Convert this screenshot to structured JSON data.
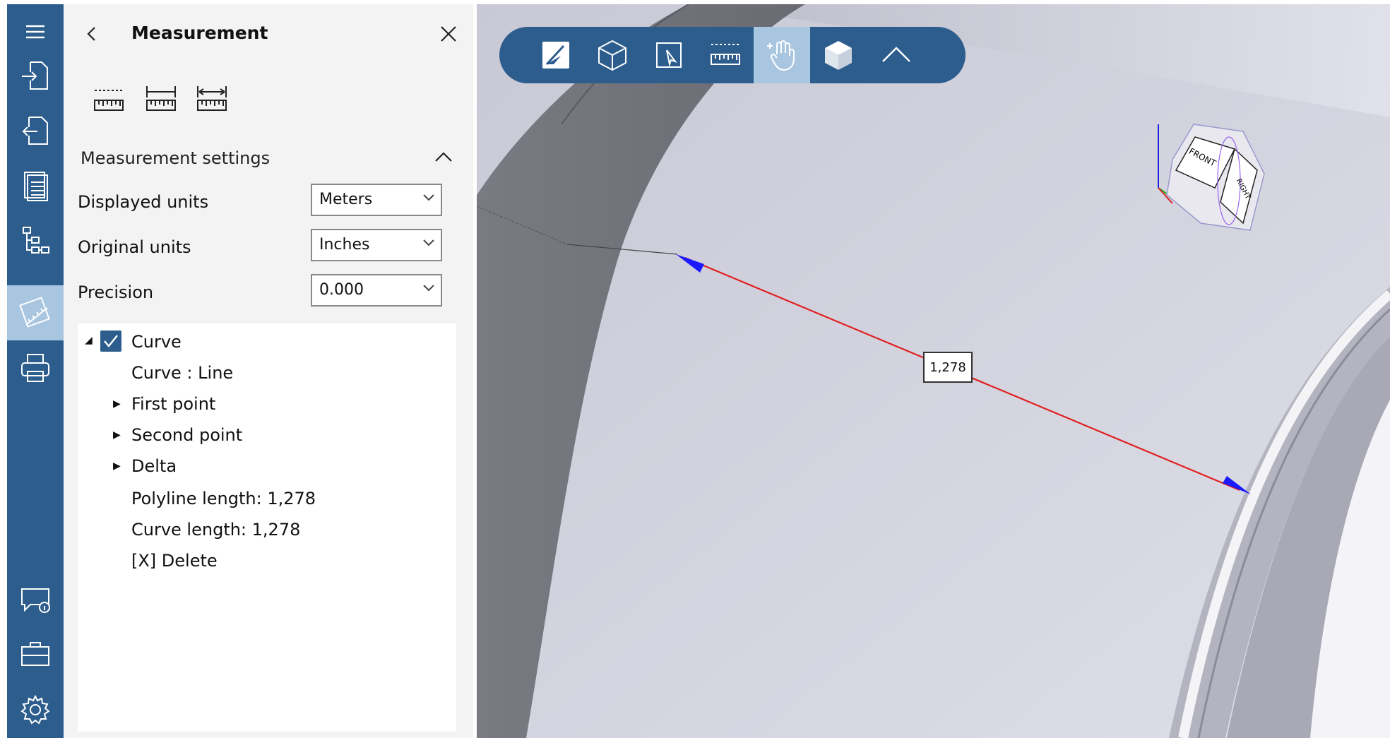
{
  "panel": {
    "title": "Measurement",
    "settings_title": "Measurement settings",
    "settings": [
      {
        "label": "Displayed units",
        "value": "Meters"
      },
      {
        "label": "Original units",
        "value": "Inches"
      },
      {
        "label": "Precision",
        "value": "0.000"
      }
    ],
    "tree": {
      "root": "Curve",
      "root_checked": true,
      "items": [
        "Curve : Line",
        "First point",
        "Second point",
        "Delta",
        "Polyline length: 1,278",
        "Curve length: 1,278",
        "[X] Delete"
      ]
    }
  },
  "viewport": {
    "measure_value": "1,278",
    "viewcube_front": "FRONT",
    "viewcube_right": "RIGHT"
  },
  "rail_icons": [
    "menu-icon",
    "import-icon",
    "export-icon",
    "document-icon",
    "hierarchy-icon",
    "measurement-icon",
    "print-icon",
    "feedback-icon",
    "toolbox-icon",
    "settings-icon"
  ],
  "toolbar_icons": [
    "section-icon",
    "wireframe-cube-icon",
    "select-icon",
    "ruler-icon",
    "pan-hand-icon",
    "solid-cube-icon",
    "collapse-icon"
  ],
  "colors": {
    "accent": "#2d5d8c",
    "active": "#a9c6e0",
    "measure_line": "#e02020",
    "arrow": "#1a1aff"
  }
}
